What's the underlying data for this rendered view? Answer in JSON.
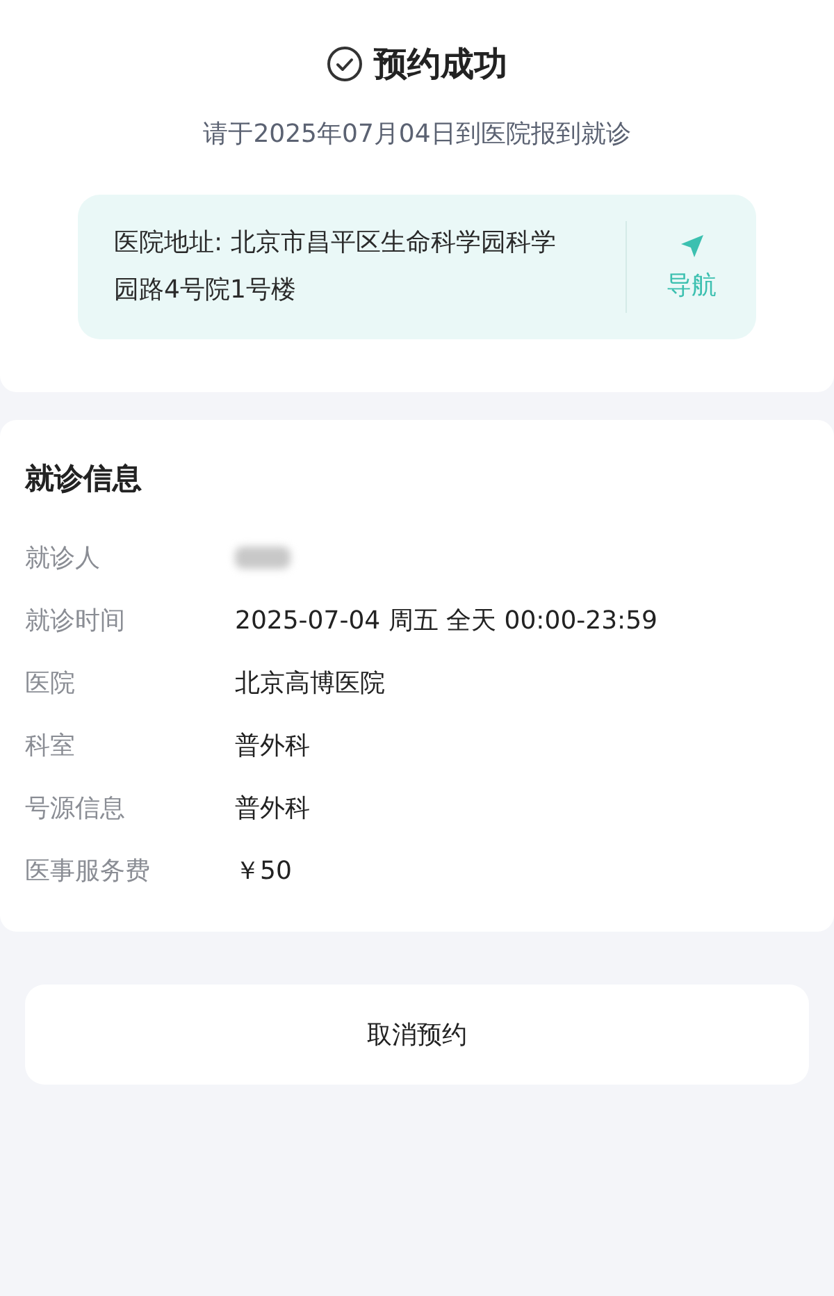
{
  "header": {
    "title": "预约成功",
    "subtitle": "请于2025年07月04日到医院报到就诊"
  },
  "address": {
    "text": "医院地址: 北京市昌平区生命科学园科学园路4号院1号楼",
    "nav_label": "导航"
  },
  "info": {
    "title": "就诊信息",
    "rows": [
      {
        "kind": "redacted",
        "label": "就诊人"
      },
      {
        "kind": "text",
        "label": "就诊时间",
        "value": "2025-07-04 周五 全天 00:00-23:59"
      },
      {
        "kind": "text",
        "label": "医院",
        "value": "北京高博医院"
      },
      {
        "kind": "text",
        "label": "科室",
        "value": "普外科"
      },
      {
        "kind": "text",
        "label": "号源信息",
        "value": "普外科"
      },
      {
        "kind": "text",
        "label": "医事服务费",
        "value": "￥50"
      }
    ]
  },
  "cancel_button": "取消预约"
}
